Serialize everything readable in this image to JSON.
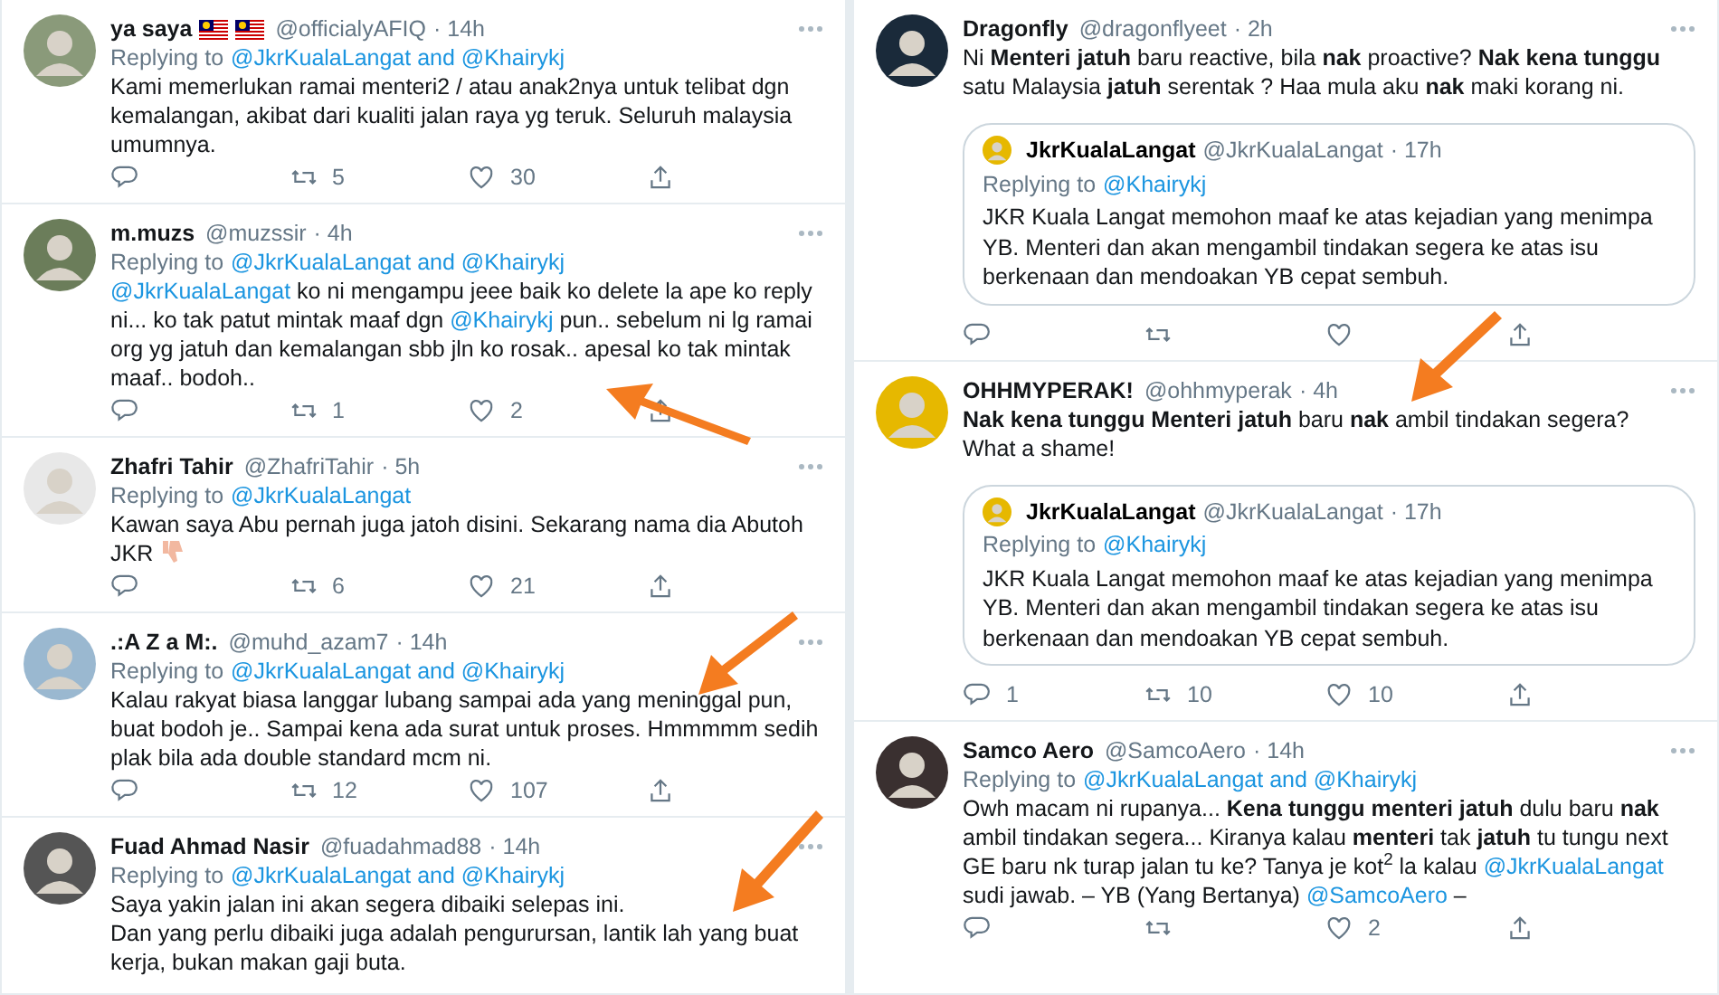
{
  "columns": [
    {
      "tweets": [
        {
          "name": "ya saya",
          "badges": [
            {
              "kind": "flag"
            },
            {
              "kind": "flag"
            }
          ],
          "handle": "@officialyAFIQ",
          "time": "· 14h",
          "replying_label": "Replying to",
          "replying_targets": "@JkrKualaLangat and @Khairykj",
          "body": [
            {
              "kind": "text",
              "text": "Kami memerlukan ramai menteri2 / atau anak2nya untuk telibat dgn kemalangan, akibat dari kualiti jalan raya yg teruk. Seluruh malaysia umumnya."
            }
          ],
          "retweets": "5",
          "likes": "30"
        },
        {
          "name": "m.muzs",
          "handle": "@muzssir",
          "time": "· 4h",
          "replying_label": "Replying to",
          "replying_targets": "@JkrKualaLangat and @Khairykj",
          "body": [
            {
              "kind": "mention",
              "text": "@JkrKualaLangat"
            },
            {
              "kind": "text",
              "text": " ko ni mengampu jeee baik ko delete la ape ko reply ni... ko tak patut mintak maaf dgn "
            },
            {
              "kind": "mention",
              "text": "@Khairykj"
            },
            {
              "kind": "text",
              "text": " pun.. sebelum ni lg ramai org yg jatuh dan kemalangan sbb jln ko rosak.. apesal ko tak mintak maaf.. bodoh.."
            }
          ],
          "retweets": "1",
          "likes": "2"
        },
        {
          "name": "Zhafri Tahir",
          "handle": "@ZhafriTahir",
          "time": "· 5h",
          "replying_label": "Replying to",
          "replying_targets": "@JkrKualaLangat",
          "body": [
            {
              "kind": "text",
              "text": "Kawan saya Abu pernah juga jatoh disini. Sekarang nama dia Abutoh JKR "
            },
            {
              "kind": "icon"
            }
          ],
          "retweets": "6",
          "likes": "21"
        },
        {
          "name": ".:A Z a M:.",
          "handle": "@muhd_azam7",
          "time": "· 14h",
          "replying_label": "Replying to",
          "replying_targets": "@JkrKualaLangat and @Khairykj",
          "body": [
            {
              "kind": "text",
              "text": "Kalau rakyat biasa langgar lubang sampai ada yang meninggal pun, buat bodoh je.. Sampai kena ada surat untuk proses. Hmmmmm sedih plak bila ada double standard mcm ni."
            }
          ],
          "retweets": "12",
          "likes": "107"
        },
        {
          "name": "Fuad Ahmad Nasir",
          "handle": "@fuadahmad88",
          "time": "· 14h",
          "replying_label": "Replying to",
          "replying_targets": "@JkrKualaLangat and @Khairykj",
          "body": [
            {
              "kind": "text",
              "text": "Saya yakin jalan ini akan segera dibaiki selepas ini.\nDan yang perlu dibaiki juga adalah pengurursan, lantik lah yang buat kerja, bukan makan gaji buta."
            }
          ]
        }
      ]
    },
    {
      "tweets": [
        {
          "name": "Dragonfly",
          "handle": "@dragonflyeet",
          "time": "· 2h",
          "body": [
            {
              "kind": "text",
              "text": "Ni **Menteri jatuh** baru reactive, bila **nak** proactive? **Nak kena tunggu** satu Malaysia **jatuh** serentak ? Haa mula aku **nak** maki korang ni."
            }
          ],
          "quote": {
            "name": "JkrKualaLangat",
            "handle": "@JkrKualaLangat",
            "time": "· 17h",
            "replying_label": "Replying to",
            "replying_targets": "@Khairykj",
            "body": "JKR Kuala Langat memohon maaf ke atas kejadian yang menimpa YB. Menteri dan akan mengambil tindakan segera ke atas isu berkenaan dan mendoakan YB cepat sembuh."
          }
        },
        {
          "name": "OHHMYPERAK!",
          "handle": "@ohhmyperak",
          "time": "· 4h",
          "body": [
            {
              "kind": "text",
              "text": "**Nak kena tunggu Menteri jatuh** baru **nak** ambil tindakan segera?\nWhat a shame!"
            }
          ],
          "quote": {
            "name": "JkrKualaLangat",
            "handle": "@JkrKualaLangat",
            "time": "· 17h",
            "replying_label": "Replying to",
            "replying_targets": "@Khairykj",
            "body": "JKR Kuala Langat memohon maaf ke atas kejadian yang menimpa YB. Menteri dan akan mengambil tindakan segera ke atas isu berkenaan dan mendoakan YB cepat sembuh."
          },
          "replies": "1",
          "retweets": "10",
          "likes": "10"
        },
        {
          "name": "Samco Aero",
          "handle": "@SamcoAero",
          "time": "· 14h",
          "replying_label": "Replying to",
          "replying_targets": "@JkrKualaLangat and @Khairykj",
          "body": [
            {
              "kind": "text",
              "text": "Owh macam ni rupanya... **Kena tunggu menteri jatuh** dulu baru **nak** ambil tindakan segera... Kiranya kalau **menteri** tak **jatuh** tu tungu next GE baru nk turap jalan tu ke? Tanya je kot$^{2}$ la kalau "
            },
            {
              "kind": "mention",
              "text": "@JkrKualaLangat"
            },
            {
              "kind": "text",
              "text": " sudi jawab. – YB (Yang Bertanya) "
            },
            {
              "kind": "mention",
              "text": "@SamcoAero"
            },
            {
              "kind": "text",
              "text": " –"
            }
          ],
          "likes": "2"
        }
      ]
    }
  ]
}
